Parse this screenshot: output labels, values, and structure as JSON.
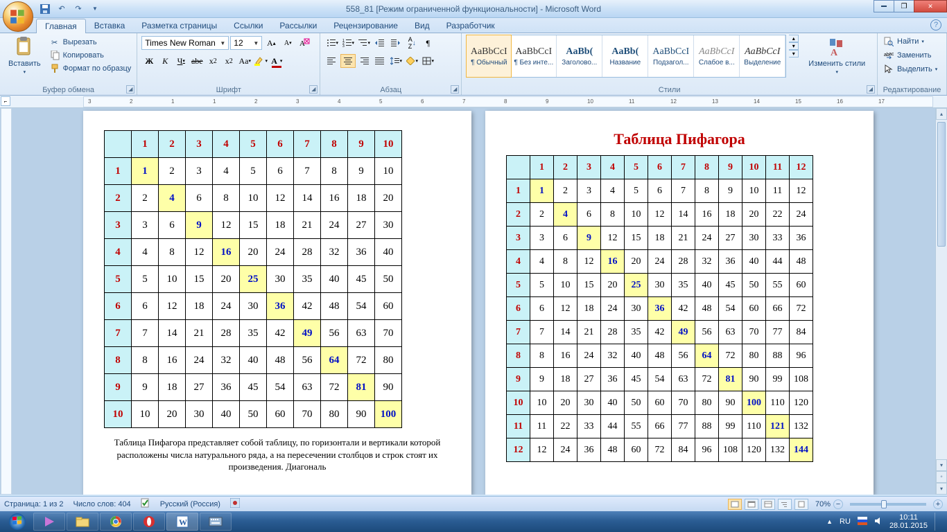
{
  "window_title": "558_81 [Режим ограниченной функциональности] - Microsoft Word",
  "ribbon_tabs": [
    "Главная",
    "Вставка",
    "Разметка страницы",
    "Ссылки",
    "Рассылки",
    "Рецензирование",
    "Вид",
    "Разработчик"
  ],
  "active_tab": 0,
  "clipboard": {
    "paste": "Вставить",
    "cut": "Вырезать",
    "copy": "Копировать",
    "format_painter": "Формат по образцу",
    "group_label": "Буфер обмена"
  },
  "font": {
    "family": "Times New Roman",
    "size": "12",
    "group_label": "Шрифт"
  },
  "paragraph": {
    "group_label": "Абзац"
  },
  "styles": {
    "group_label": "Стили",
    "change_styles": "Изменить стили",
    "items": [
      {
        "sample": "AaBbCcI",
        "label": "¶ Обычный",
        "italic": false,
        "bold": false,
        "color": "#333",
        "active": true
      },
      {
        "sample": "AaBbCcI",
        "label": "¶ Без инте...",
        "italic": false,
        "bold": false,
        "color": "#333"
      },
      {
        "sample": "AaBb(",
        "label": "Заголово...",
        "italic": false,
        "bold": true,
        "color": "#1f4e79"
      },
      {
        "sample": "AaBb(",
        "label": "Название",
        "italic": false,
        "bold": true,
        "color": "#1f4e79"
      },
      {
        "sample": "AaBbCcI",
        "label": "Подзагол...",
        "italic": false,
        "bold": false,
        "color": "#1f4e79"
      },
      {
        "sample": "AaBbCcI",
        "label": "Слабое в...",
        "italic": true,
        "bold": false,
        "color": "#888"
      },
      {
        "sample": "AaBbCcI",
        "label": "Выделение",
        "italic": true,
        "bold": false,
        "color": "#333"
      }
    ]
  },
  "editing": {
    "group_label": "Редактирование",
    "find": "Найти",
    "replace": "Заменить",
    "select": "Выделить"
  },
  "ruler_marks": [
    "3",
    "2",
    "1",
    "1",
    "2",
    "3",
    "4",
    "5",
    "6",
    "7",
    "8",
    "9",
    "10",
    "11",
    "12",
    "13",
    "14",
    "15",
    "16",
    "17"
  ],
  "document": {
    "page2_title": "Таблица Пифагора",
    "page1_text": "Таблица Пифагора представляет собой таблицу, по горизонтали и вертикали которой расположены числа натурального ряда, а на пересечении столбцов и строк стоят их произведения. Диагональ",
    "table1_size": 10,
    "table2_size": 12
  },
  "status": {
    "page": "Страница: 1 из 2",
    "words": "Число слов: 404",
    "lang": "Русский (Россия)",
    "zoom": "70%"
  },
  "tray": {
    "lang": "RU",
    "time": "10:11",
    "date": "28.01.2015"
  }
}
